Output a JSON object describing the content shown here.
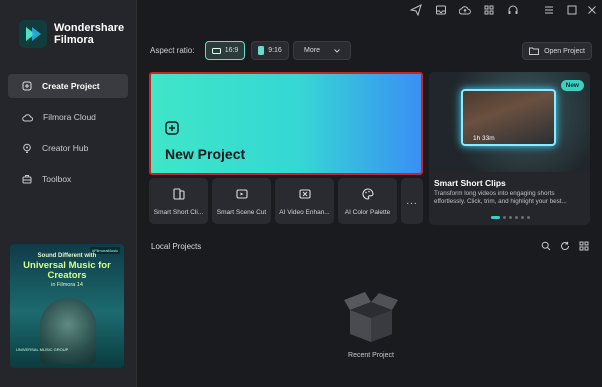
{
  "app": {
    "name_line1": "Wondershare",
    "name_line2": "Filmora"
  },
  "sidebar": {
    "items": [
      {
        "label": "Create Project",
        "icon": "plus-square-icon",
        "active": true
      },
      {
        "label": "Filmora Cloud",
        "icon": "cloud-icon",
        "active": false
      },
      {
        "label": "Creator Hub",
        "icon": "bulb-icon",
        "active": false
      },
      {
        "label": "Toolbox",
        "icon": "toolbox-icon",
        "active": false
      }
    ],
    "promo": {
      "tag": "#FilmoraMusic",
      "line1": "Sound Different with",
      "line2": "Universal Music for Creators",
      "line3": "in Filmora 14",
      "brand": "UNIVERSAL MUSIC GROUP"
    }
  },
  "topbar": {
    "icons": [
      "send-icon",
      "inbox-icon",
      "cloud-upload-icon",
      "grid-icon",
      "headset-icon",
      "menu-icon",
      "minimize-icon",
      "maximize-icon",
      "close-icon"
    ]
  },
  "aspect": {
    "label": "Aspect ratio:",
    "options": [
      {
        "label": "16:9",
        "selected": true
      },
      {
        "label": "9:16",
        "selected": false
      }
    ],
    "more_label": "More"
  },
  "open_project_label": "Open Project",
  "new_project": {
    "title": "New Project",
    "gradient_start": "#3fe6c8",
    "gradient_end": "#3a8ff4",
    "highlight_color": "#c42727"
  },
  "tools": [
    {
      "label": "Smart Short Cli...",
      "icon": "smart-short-clips-icon"
    },
    {
      "label": "Smart Scene Cut",
      "icon": "scene-cut-icon"
    },
    {
      "label": "AI Video Enhan...",
      "icon": "video-enhance-icon"
    },
    {
      "label": "AI Color Palette",
      "icon": "palette-icon"
    },
    {
      "label": "...",
      "icon": "more-icon"
    }
  ],
  "feature_card": {
    "badge": "New",
    "duration": "1h 33m",
    "title": "Smart Short Clips",
    "description": "Transform long videos into engaging shorts effortlessly. Click, trim, and highlight your best...",
    "slides": 6,
    "active_slide": 0
  },
  "local_projects": {
    "title": "Local Projects",
    "empty_label": "Recent Project",
    "icons": [
      "search-icon",
      "refresh-icon",
      "grid-view-icon"
    ]
  },
  "colors": {
    "accent": "#3ad1c0",
    "background": "#1a1b1f",
    "sidebar": "#25262b"
  }
}
